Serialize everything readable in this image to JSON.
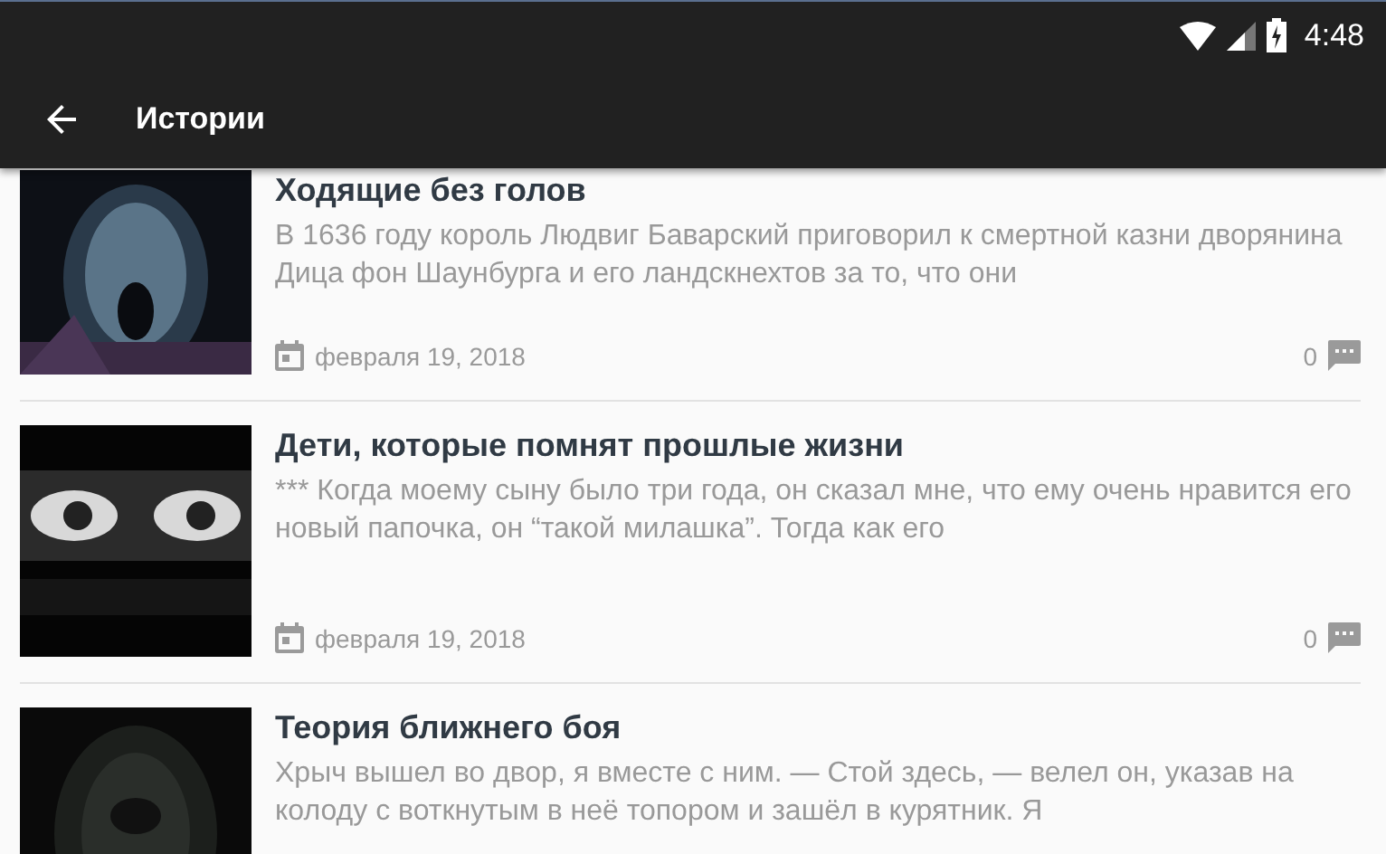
{
  "status_bar": {
    "time": "4:48"
  },
  "app_bar": {
    "title": "Истории"
  },
  "stories": [
    {
      "title": "Ходящие без голов",
      "excerpt": "В 1636 году король Людвиг Баварский приговорил к смертной казни дворянина Дица фон Шаунбурга и его ландскнехтов за то, что они",
      "date": "февраля 19, 2018",
      "comments": "0"
    },
    {
      "title": "Дети, которые помнят прошлые жизни",
      "excerpt": "*** Когда моему сыну было три года, он сказал мне, что ему очень нравится его новый папочка, он “такой милашка”. Тогда как его",
      "date": "февраля 19, 2018",
      "comments": "0"
    },
    {
      "title": "Теория ближнего боя",
      "excerpt": "Хрыч вышел во двор, я вместе с ним. — Стой здесь, — велел он, указав на колоду с воткнутым в неё топором и зашёл в курятник. Я"
    }
  ]
}
